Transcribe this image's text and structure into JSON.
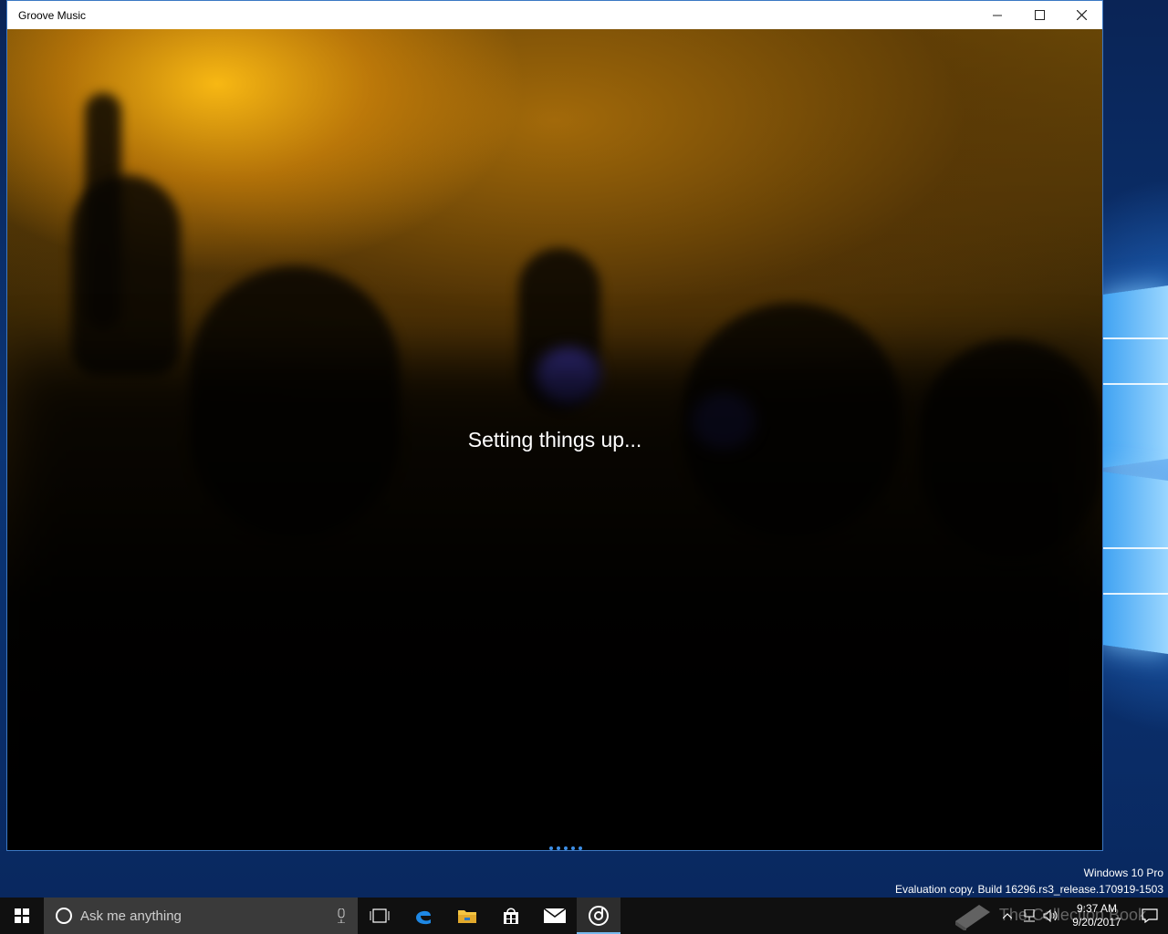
{
  "window": {
    "title": "Groove Music",
    "controls": {
      "minimize": "minimize-icon",
      "maximize": "maximize-icon",
      "close": "close-icon"
    }
  },
  "app": {
    "status_text": "Setting things up...",
    "progress_indicator": "indeterminate"
  },
  "desktop": {
    "watermark_line1": "Windows 10 Pro",
    "watermark_line2": "Evaluation copy. Build 16296.rs3_release.170919-1503"
  },
  "taskbar": {
    "search_placeholder": "Ask me anything",
    "pinned": [
      {
        "name": "task-view",
        "icon": "task-view-icon"
      },
      {
        "name": "edge",
        "icon": "edge-icon"
      },
      {
        "name": "file-explorer",
        "icon": "folder-icon"
      },
      {
        "name": "store",
        "icon": "store-icon"
      },
      {
        "name": "mail",
        "icon": "mail-icon"
      },
      {
        "name": "groove-music",
        "icon": "groove-icon",
        "active": true
      }
    ],
    "clock": {
      "time": "9:37 AM",
      "date": "9/20/2017"
    },
    "overlay_text": "The Collection Book"
  },
  "colors": {
    "accent": "#3d8ee6",
    "taskbar_bg": "#101010",
    "titlebar_bg": "#ffffff"
  }
}
